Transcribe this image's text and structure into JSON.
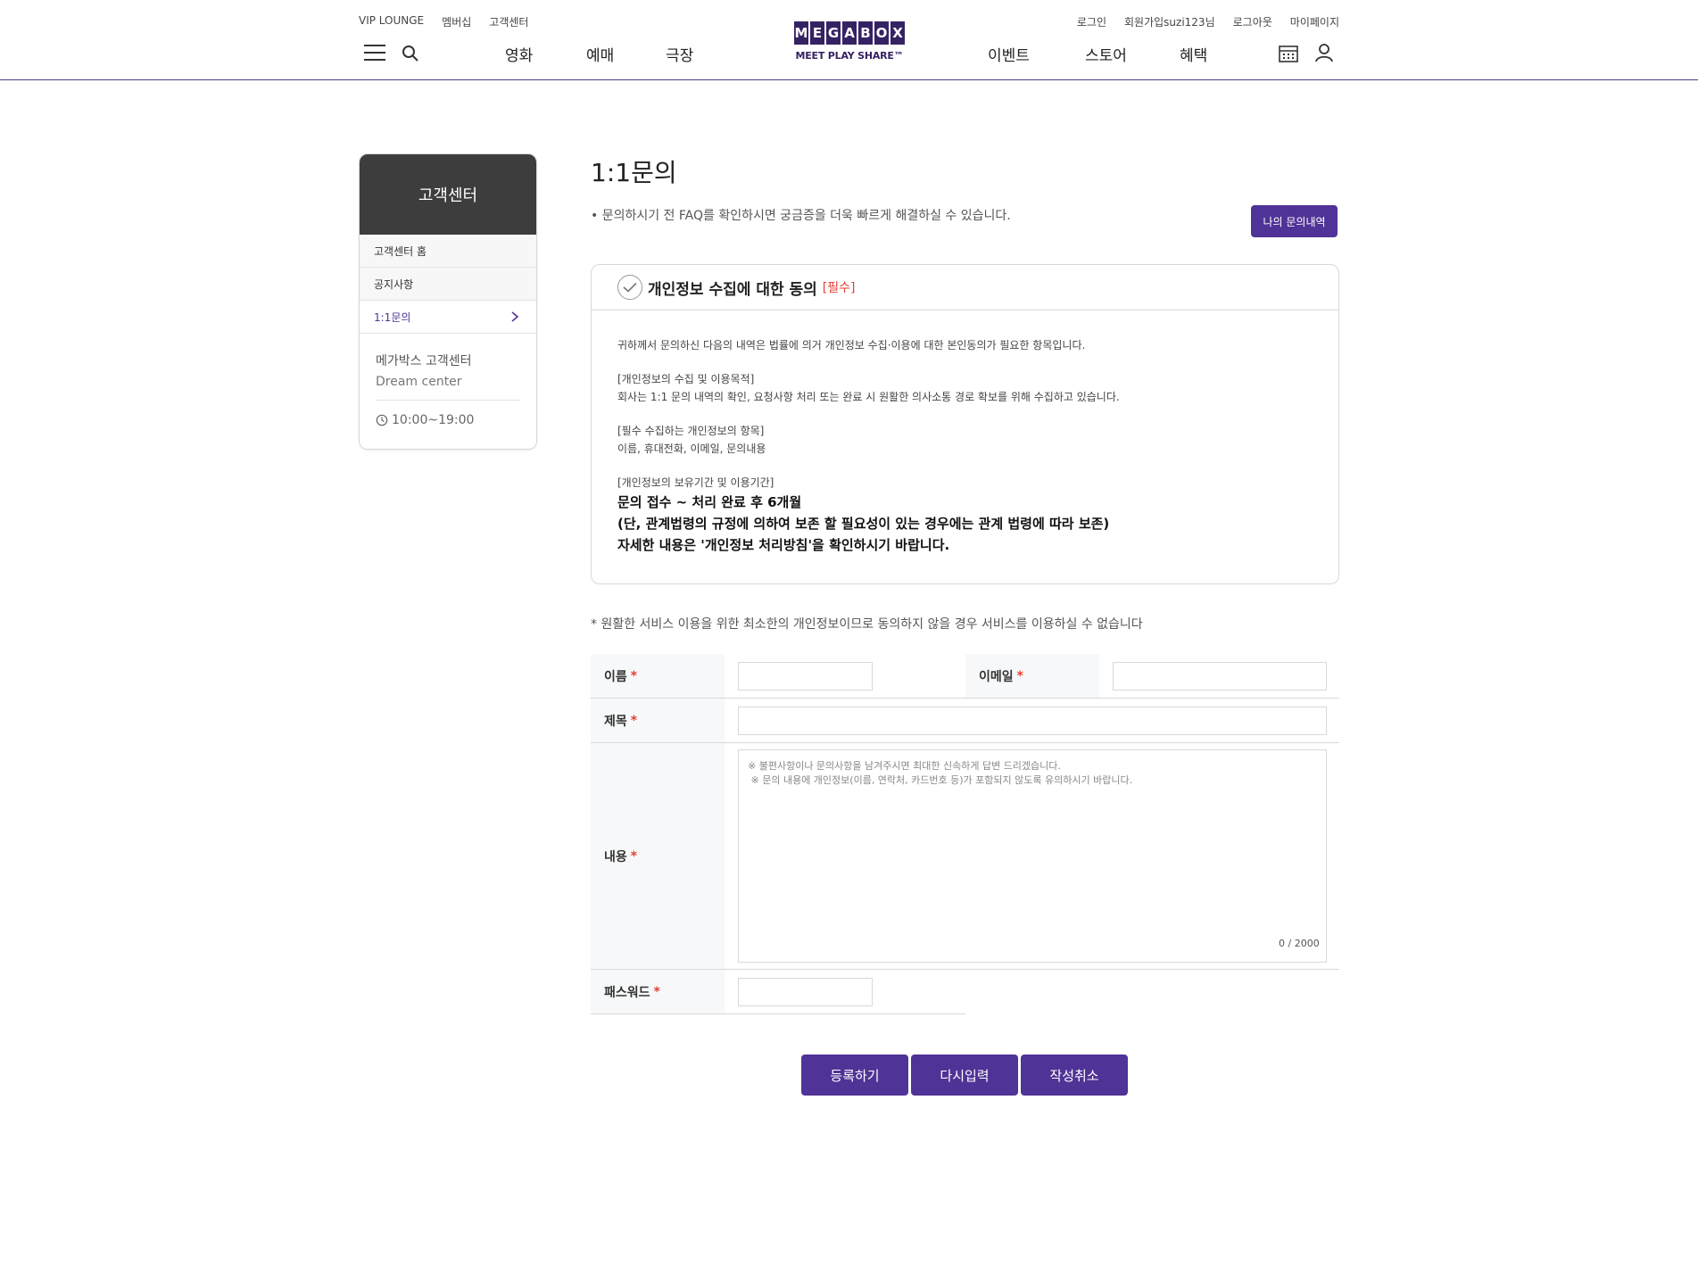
{
  "header": {
    "util_left": [
      "VIP LOUNGE",
      "멤버십",
      "고객센터"
    ],
    "util_right": [
      "로그인",
      "회원가입suzi123님",
      "로그아웃",
      "마이페이지"
    ],
    "nav_left": [
      "영화",
      "예매",
      "극장"
    ],
    "nav_right": [
      "이벤트",
      "스토어",
      "혜택"
    ],
    "logo": {
      "top": "MEGABOX",
      "bottom": "MEET PLAY SHARE™"
    },
    "brand_color": "#352263",
    "icons": [
      "menu-icon",
      "search-icon",
      "calendar-icon",
      "user-icon"
    ]
  },
  "sidebar": {
    "title": "고객센터",
    "items": [
      {
        "label": "고객센터 홈",
        "active": false
      },
      {
        "label": "공지사항",
        "active": false
      },
      {
        "label": "1:1문의",
        "active": true
      }
    ],
    "center_name": "메가박스 고객센터",
    "center_en": "Dream center",
    "hours": "10:00~19:00"
  },
  "main": {
    "title": "1:1문의",
    "notice": "• 문의하시기 전 FAQ를 확인하시면 궁금증을 더욱 빠르게 해결하실 수 있습니다.",
    "my_inquiry_button": "나의 문의내역",
    "agree": {
      "title": "개인정보 수집에 대한 동의",
      "required": "[필수]",
      "intro": "귀하께서 문의하신 다음의 내역은 법률에 의거 개인정보 수집·이용에 대한 본인동의가 필요한 항목입니다.",
      "purpose_title": "[개인정보의 수집 및 이용목적]",
      "purpose_text": "회사는 1:1 문의 내역의 확인, 요청사항 처리 또는 완료 시 원활한 의사소통 경로 확보를 위해 수집하고 있습니다.",
      "items_title": "[필수 수집하는 개인정보의 항목]",
      "items_text": "이름, 휴대전화, 이메일, 문의내용",
      "period_title": "[개인정보의 보유기간 및 이용기간]",
      "period_line1": "문의 접수 ~ 처리 완료 후 6개월",
      "period_line2": "(단, 관계법령의 규정에 의하여 보존 할 필요성이 있는 경우에는 관계 법령에 따라 보존)",
      "period_line3": "자세한 내용은 '개인정보 처리방침'을 확인하시기 바랍니다."
    },
    "warning": "* 원활한 서비스 이용을 위한 최소한의 개인정보이므로 동의하지 않을 경우 서비스를 이용하실 수 없습니다",
    "form": {
      "required_mark": "*",
      "name_label": "이름",
      "email_label": "이메일",
      "subject_label": "제목",
      "content_label": "내용",
      "password_label": "패스워드",
      "name_value": "",
      "email_value": "",
      "subject_value": "",
      "password_value": "",
      "content_placeholder": "※ 불편사항이나 문의사항을 남겨주시면 최대한 신속하게 답변 드리겠습니다.\n ※ 문의 내용에 개인정보(이름, 연락처, 카드번호 등)가 포함되지 않도록 유의하시기 바랍니다.",
      "counter": "0 / 2000"
    },
    "buttons": {
      "submit": "등록하기",
      "reset": "다시입력",
      "cancel": "작성취소"
    }
  }
}
